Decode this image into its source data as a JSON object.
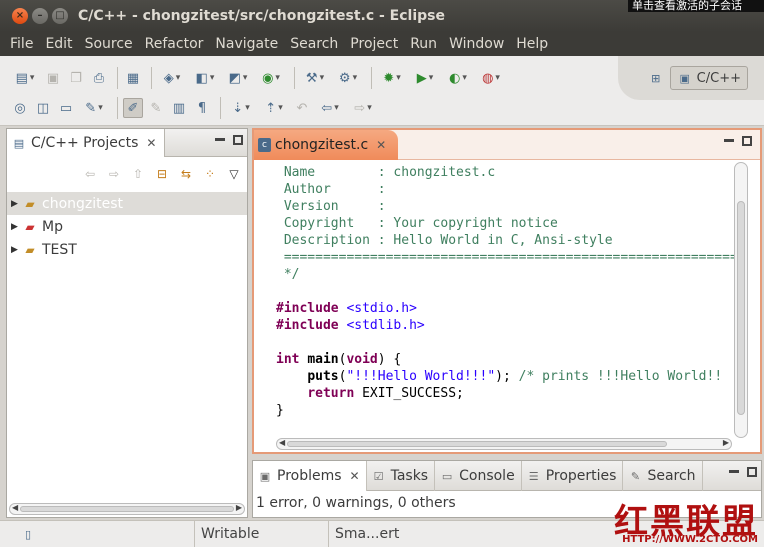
{
  "window": {
    "title": "C/C++ - chongzitest/src/chongzitest.c - Eclipse",
    "overlay_text": "单击查看激活的子会话"
  },
  "menubar": [
    "File",
    "Edit",
    "Source",
    "Refactor",
    "Navigate",
    "Search",
    "Project",
    "Run",
    "Window",
    "Help"
  ],
  "perspective": {
    "label": "C/C++"
  },
  "project_explorer": {
    "tab_label": "C/C++ Projects",
    "items": [
      {
        "label": "chongzitest",
        "selected": true,
        "error": false
      },
      {
        "label": "Mp",
        "selected": false,
        "error": true
      },
      {
        "label": "TEST",
        "selected": false,
        "error": false
      }
    ]
  },
  "editor": {
    "tab_label": "chongzitest.c",
    "code": {
      "l1_key": "Name",
      "l1_val": "chongzitest.c",
      "l2_key": "Author",
      "l3_key": "Version",
      "l4_key": "Copyright",
      "l4_val": "Your copyright notice",
      "l5_key": "Description",
      "l5_val": "Hello World in C, Ansi-style",
      "separator": "===========================================================",
      "end_comment": "*/",
      "include_kw": "#include",
      "include1": "<stdio.h>",
      "include2": "<stdlib.h>",
      "int_kw": "int",
      "main_fn": "main",
      "void_kw": "void",
      "puts_fn": "puts",
      "string_lit": "\"!!!Hello World!!!\"",
      "trailing_comment": "/* prints !!!Hello World!!",
      "return_kw": "return",
      "exit_val": "EXIT_SUCCESS;",
      "close_brace": "}"
    }
  },
  "bottom_panel": {
    "tabs": [
      "Problems",
      "Tasks",
      "Console",
      "Properties",
      "Search"
    ],
    "status_text": "1 error, 0 warnings, 0 others"
  },
  "statusbar": {
    "writable": "Writable",
    "insert_mode": "Sma...ert"
  },
  "watermark": {
    "text": "红黑联盟",
    "url": "HTTP://WWW.2CTO.COM"
  },
  "colors": {
    "title_bg": "#3c3b37",
    "editor_tab_accent": "#f08b5a",
    "comment": "#3f7f5f",
    "keyword": "#7f0055",
    "string": "#2a00ff"
  }
}
